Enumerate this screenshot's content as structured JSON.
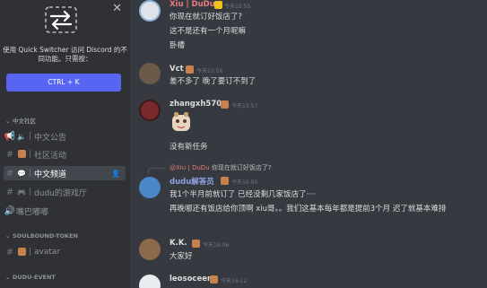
{
  "sidebar": {
    "quick_switcher": {
      "description": "使用 Quick Switcher 访问 Discord 的不同功能。只需按：",
      "shortcut_label": "CTRL + K"
    },
    "categories": {
      "c1": "中文社区",
      "c2": "SOULBOUND-TOKEN",
      "c3": "DUDU-EVENT"
    },
    "channels": {
      "ch1": "中文公告",
      "ch2": "社区活动",
      "ch3": "中文频道",
      "ch4": "dudu的游戏厅",
      "ch5": "嘴巴嘟嘟",
      "ch6": "avatar"
    }
  },
  "chat": {
    "messages": [
      {
        "author": "Xiu | DuDu",
        "time": "今天15:55",
        "lines": [
          "你现在就订好饭店了?",
          "这不是还有一个月呢嘛",
          "卧槽"
        ]
      },
      {
        "author": "Vct",
        "time": "今天15:56",
        "lines": [
          "差不多了  晚了要订不到了"
        ]
      },
      {
        "author": "zhangxh570",
        "time": "今天15:57",
        "lines": [
          "没有新任务"
        ]
      },
      {
        "author": "dudu解答员",
        "time": "今天16:05",
        "lines": [
          "我1个半月前就订了 已经没剩几家饭店了····",
          "再晚哪还有饭店给你顶啊 xiu哥。。我们这基本每年都是提前3个月 迟了就基本难排"
        ]
      },
      {
        "author": "K.K.",
        "time": "今天16:06",
        "lines": [
          "大家好"
        ]
      },
      {
        "author": "leosoceer",
        "time": "今天16:12",
        "lines": []
      }
    ],
    "reply": {
      "author": "@Xiu | DuDu",
      "text": "你现在就订好饭店了?"
    }
  },
  "colors": {
    "accent": "#5865f2",
    "sidebar_bg": "#2f3136",
    "chat_bg": "#36393f",
    "name_red": "#e67c7c",
    "name_blue": "#8ea1e1"
  }
}
